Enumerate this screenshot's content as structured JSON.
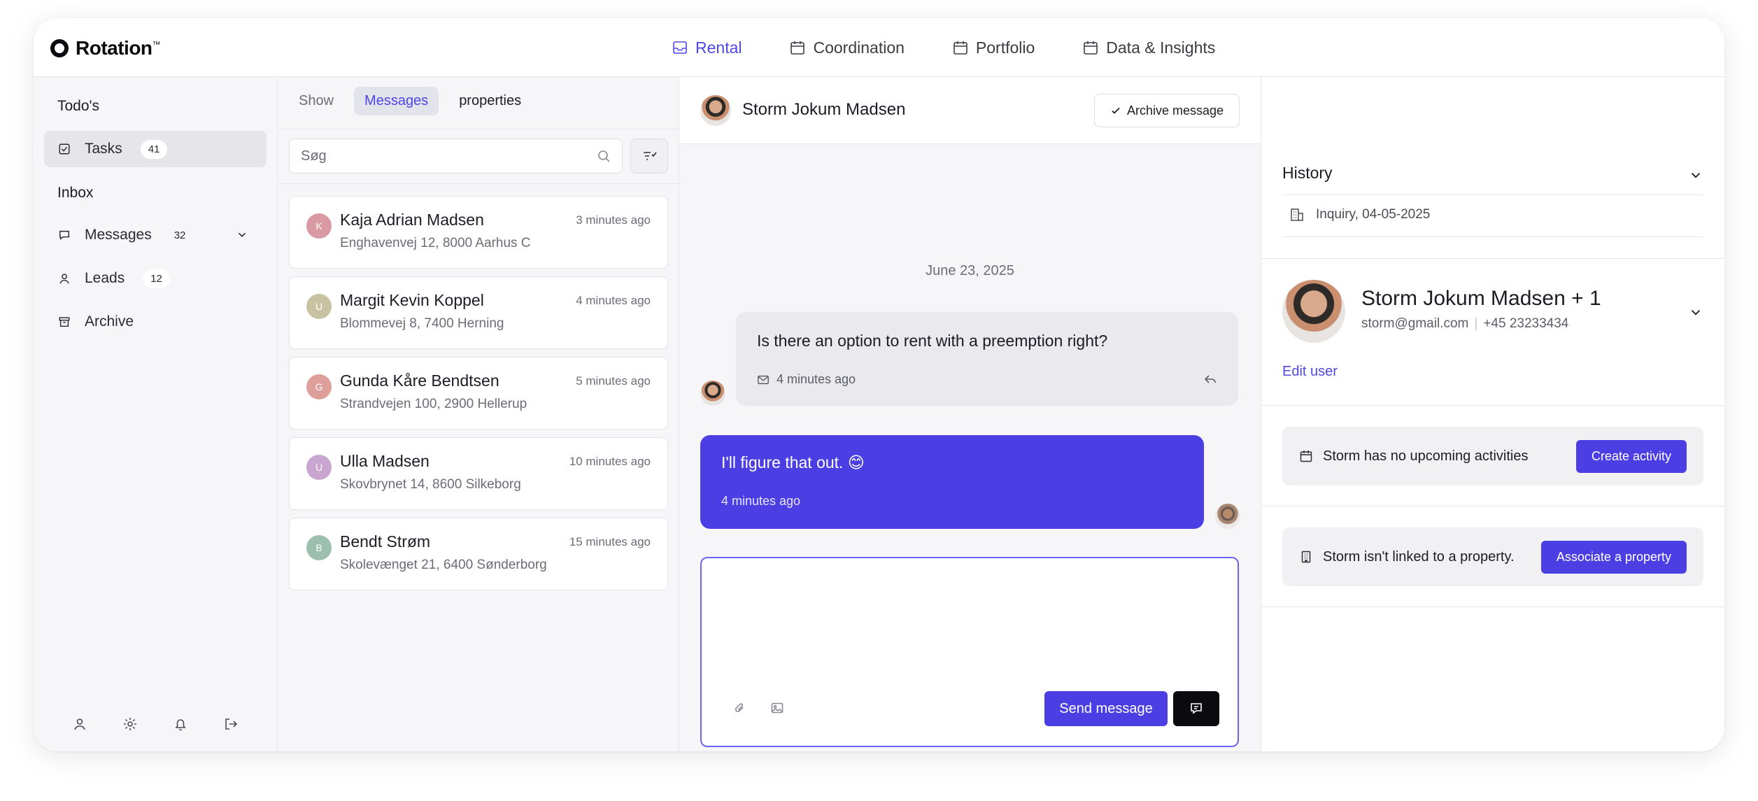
{
  "brand": {
    "name": "Rotation",
    "trademark": "™"
  },
  "nav": [
    {
      "label": "Rental",
      "active": true,
      "icon": "inbox-icon"
    },
    {
      "label": "Coordination",
      "active": false,
      "icon": "calendar-icon"
    },
    {
      "label": "Portfolio",
      "active": false,
      "icon": "calendar-icon"
    },
    {
      "label": "Data & Insights",
      "active": false,
      "icon": "calendar-icon"
    }
  ],
  "sidebar": {
    "todos_heading": "Todo's",
    "tasks": {
      "label": "Tasks",
      "count": "41"
    },
    "inbox_heading": "Inbox",
    "messages": {
      "label": "Messages",
      "count": "32"
    },
    "leads": {
      "label": "Leads",
      "count": "12"
    },
    "archive": {
      "label": "Archive"
    }
  },
  "list": {
    "tabs": [
      "Show",
      "Messages",
      "properties"
    ],
    "search_placeholder": "Søg",
    "items": [
      {
        "initial": "K",
        "name": "Kaja Adrian Madsen",
        "address": "Enghavenvej 12, 8000 Aarhus C",
        "time": "3 minutes ago",
        "color": "#d99aa3"
      },
      {
        "initial": "U",
        "name": "Margit Kevin Koppel",
        "address": "Blommevej 8, 7400 Herning",
        "time": "4 minutes ago",
        "color": "#c9c2a2"
      },
      {
        "initial": "G",
        "name": "Gunda Kåre Bendtsen",
        "address": "Strandvejen 100, 2900 Hellerup",
        "time": "5 minutes ago",
        "color": "#de9f9a"
      },
      {
        "initial": "U",
        "name": "Ulla Madsen",
        "address": "Skovbrynet 14, 8600 Silkeborg",
        "time": "10 minutes ago",
        "color": "#c8a6cf"
      },
      {
        "initial": "B",
        "name": "Bendt Strøm",
        "address": "Skolevænget 21, 6400 Sønderborg",
        "time": "15 minutes ago",
        "color": "#9dbfae"
      }
    ]
  },
  "conversation": {
    "contact_name": "Storm Jokum Madsen",
    "archive_label": "Archive message",
    "date": "June 23, 2025",
    "incoming": {
      "text": "Is there an option to rent with a preemption right?",
      "time": "4 minutes ago"
    },
    "outgoing": {
      "text": "I'll figure that out. 😊",
      "time": "4 minutes ago"
    },
    "composer": {
      "value": "",
      "send_label": "Send message"
    }
  },
  "details": {
    "history_label": "History",
    "history_entry": "Inquiry, 04-05-2025",
    "profile_name": "Storm Jokum Madsen + 1",
    "email": "storm@gmail.com",
    "phone": "+45 23233434",
    "edit_label": "Edit user",
    "activities_text": "Storm has no upcoming activities",
    "activities_button": "Create activity",
    "property_text": "Storm isn't linked to a property.",
    "property_button": "Associate a property"
  },
  "colors": {
    "accent": "#4b3fe3",
    "accent_text": "#5046e5",
    "background": "#f6f6f8"
  }
}
